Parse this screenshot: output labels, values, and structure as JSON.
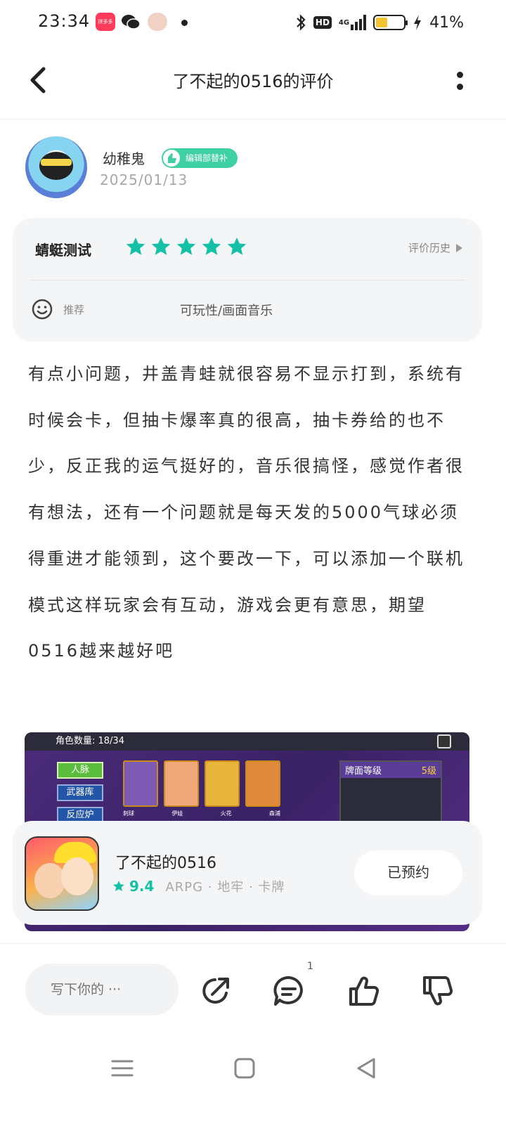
{
  "status_bar": {
    "time": "23:34",
    "battery": "41%",
    "network": "4G",
    "hd": "HD",
    "app1_label": "拼多多"
  },
  "header": {
    "title": "了不起的0516的评价"
  },
  "author": {
    "name": "幼稚鬼",
    "badge": "编辑部替补",
    "date": "2025/01/13"
  },
  "rating": {
    "label": "蜻蜓测试",
    "stars": 5,
    "history_label": "评价历史",
    "recommend_label": "推荐",
    "tags": "可玩性/画面音乐",
    "star_color": "#14c1a6"
  },
  "review_text": "有点小问题，井盖青蛙就很容易不显示打到，系统有时候会卡，但抽卡爆率真的很高，抽卡券给的也不少，反正我的运气挺好的，音乐很搞怪，感觉作者很有想法，还有一个问题就是每天发的5000气球必须得重进才能领到，这个要改一下，可以添加一个联机模式这样玩家会有互动，游戏会更有意思，期望0516越来越好吧",
  "screenshot": {
    "role_count": "角色数量: 18/34",
    "menu": [
      "人脉",
      "武器库",
      "反应炉"
    ],
    "cards": [
      "刺球",
      "伊娃",
      "火花",
      "森浦"
    ],
    "panel_title": "牌面等级",
    "panel_level": "5级"
  },
  "game": {
    "title": "了不起的0516",
    "score": "9.4",
    "genre": "ARPG · 地牢 · 卡牌",
    "reserve_label": "已预约"
  },
  "actions": {
    "comment_placeholder": "写下你的 ···",
    "comment_count": "1"
  },
  "colors": {
    "accent": "#14c1a6",
    "badge": "#3fd1a4",
    "card_bg": "#f4f5f7"
  }
}
